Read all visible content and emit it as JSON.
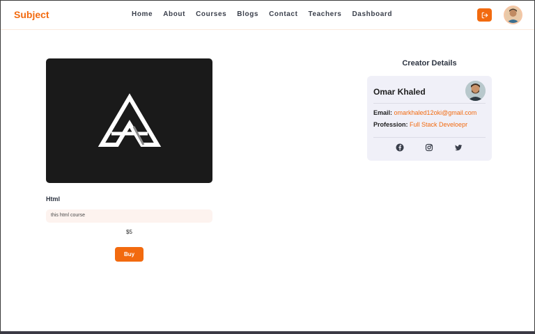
{
  "navbar": {
    "brand": "Subject",
    "links": [
      "Home",
      "About",
      "Courses",
      "Blogs",
      "Contact",
      "Teachers",
      "Dashboard"
    ]
  },
  "course": {
    "title": "Html",
    "description": "this html course",
    "price": "$5",
    "buy_label": "Buy"
  },
  "creator": {
    "heading": "Creator Details",
    "name": "Omar Khaled",
    "email_label": "Email:",
    "email": "omarkhaled12oki@gmail.com",
    "profession_label": "Profession:",
    "profession": "Full Stack Develoepr",
    "socials": [
      "facebook-icon",
      "instagram-icon",
      "twitter-icon"
    ]
  },
  "colors": {
    "accent": "#f26a0f",
    "card_bg": "#f0f0f8",
    "course_image_bg": "#1a1a1a"
  }
}
